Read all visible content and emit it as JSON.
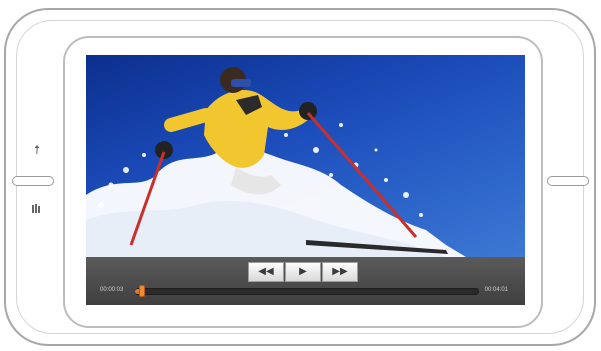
{
  "player": {
    "current_time": "00:00:03",
    "duration": "00:04:01",
    "progress_fraction": 0.012,
    "controls": {
      "rewind_icon": "rewind-icon",
      "play_icon": "play-icon",
      "fast_forward_icon": "fast-forward-icon"
    }
  },
  "device": {
    "side_icons": [
      "arrow-up-icon",
      "grid-icon"
    ]
  },
  "colors": {
    "progress": "#e07a2b",
    "sky": "#1b4bb9"
  }
}
